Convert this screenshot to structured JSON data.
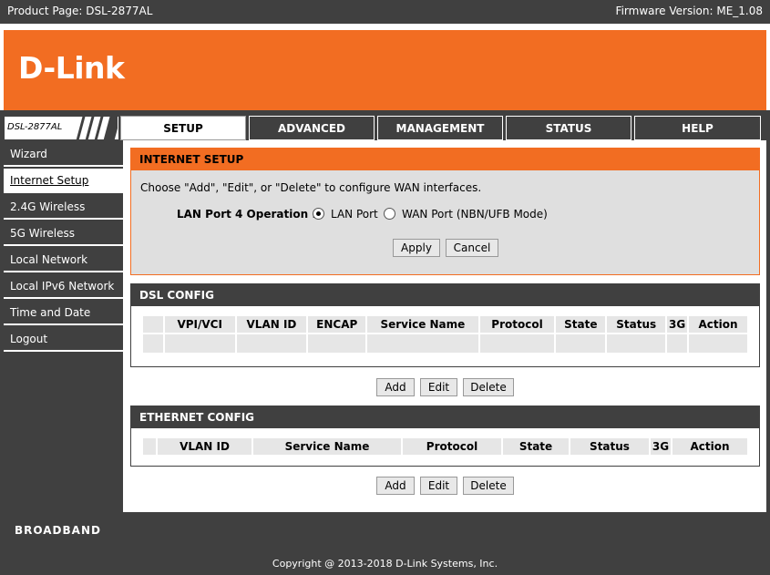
{
  "header": {
    "product_page": "Product Page: DSL-2877AL",
    "firmware": "Firmware Version: ME_1.08"
  },
  "brand": {
    "logo": "D-Link",
    "model": "DSL-2877AL",
    "accent_color": "#f26d22",
    "dark_color": "#404040"
  },
  "tabs": [
    {
      "label": "SETUP",
      "active": true
    },
    {
      "label": "ADVANCED",
      "active": false
    },
    {
      "label": "MANAGEMENT",
      "active": false
    },
    {
      "label": "STATUS",
      "active": false
    },
    {
      "label": "HELP",
      "active": false
    }
  ],
  "sidebar": {
    "items": [
      {
        "label": "Wizard",
        "active": false
      },
      {
        "label": "Internet Setup",
        "active": true
      },
      {
        "label": "2.4G Wireless",
        "active": false
      },
      {
        "label": "5G Wireless",
        "active": false
      },
      {
        "label": "Local Network",
        "active": false
      },
      {
        "label": "Local IPv6 Network",
        "active": false
      },
      {
        "label": "Time and Date",
        "active": false
      },
      {
        "label": "Logout",
        "active": false
      }
    ]
  },
  "internet_setup": {
    "title": "INTERNET SETUP",
    "description": "Choose \"Add\", \"Edit\", or \"Delete\" to configure WAN interfaces.",
    "lan_port_label": "LAN Port 4 Operation :",
    "options": [
      {
        "label": "LAN Port",
        "checked": true
      },
      {
        "label": "WAN Port (NBN/UFB Mode)",
        "checked": false
      }
    ],
    "apply_label": "Apply",
    "cancel_label": "Cancel"
  },
  "dsl_config": {
    "title": "DSL CONFIG",
    "columns": [
      "",
      "VPI/VCI",
      "VLAN ID",
      "ENCAP",
      "Service Name",
      "Protocol",
      "State",
      "Status",
      "3G",
      "Action"
    ],
    "rows": [],
    "add_label": "Add",
    "edit_label": "Edit",
    "delete_label": "Delete"
  },
  "ethernet_config": {
    "title": "ETHERNET CONFIG",
    "columns": [
      "",
      "VLAN ID",
      "Service Name",
      "Protocol",
      "State",
      "Status",
      "3G",
      "Action"
    ],
    "rows": [],
    "add_label": "Add",
    "edit_label": "Edit",
    "delete_label": "Delete"
  },
  "footer": {
    "broadband": "BROADBAND",
    "copyright": "Copyright @ 2013-2018 D-Link Systems, Inc."
  }
}
